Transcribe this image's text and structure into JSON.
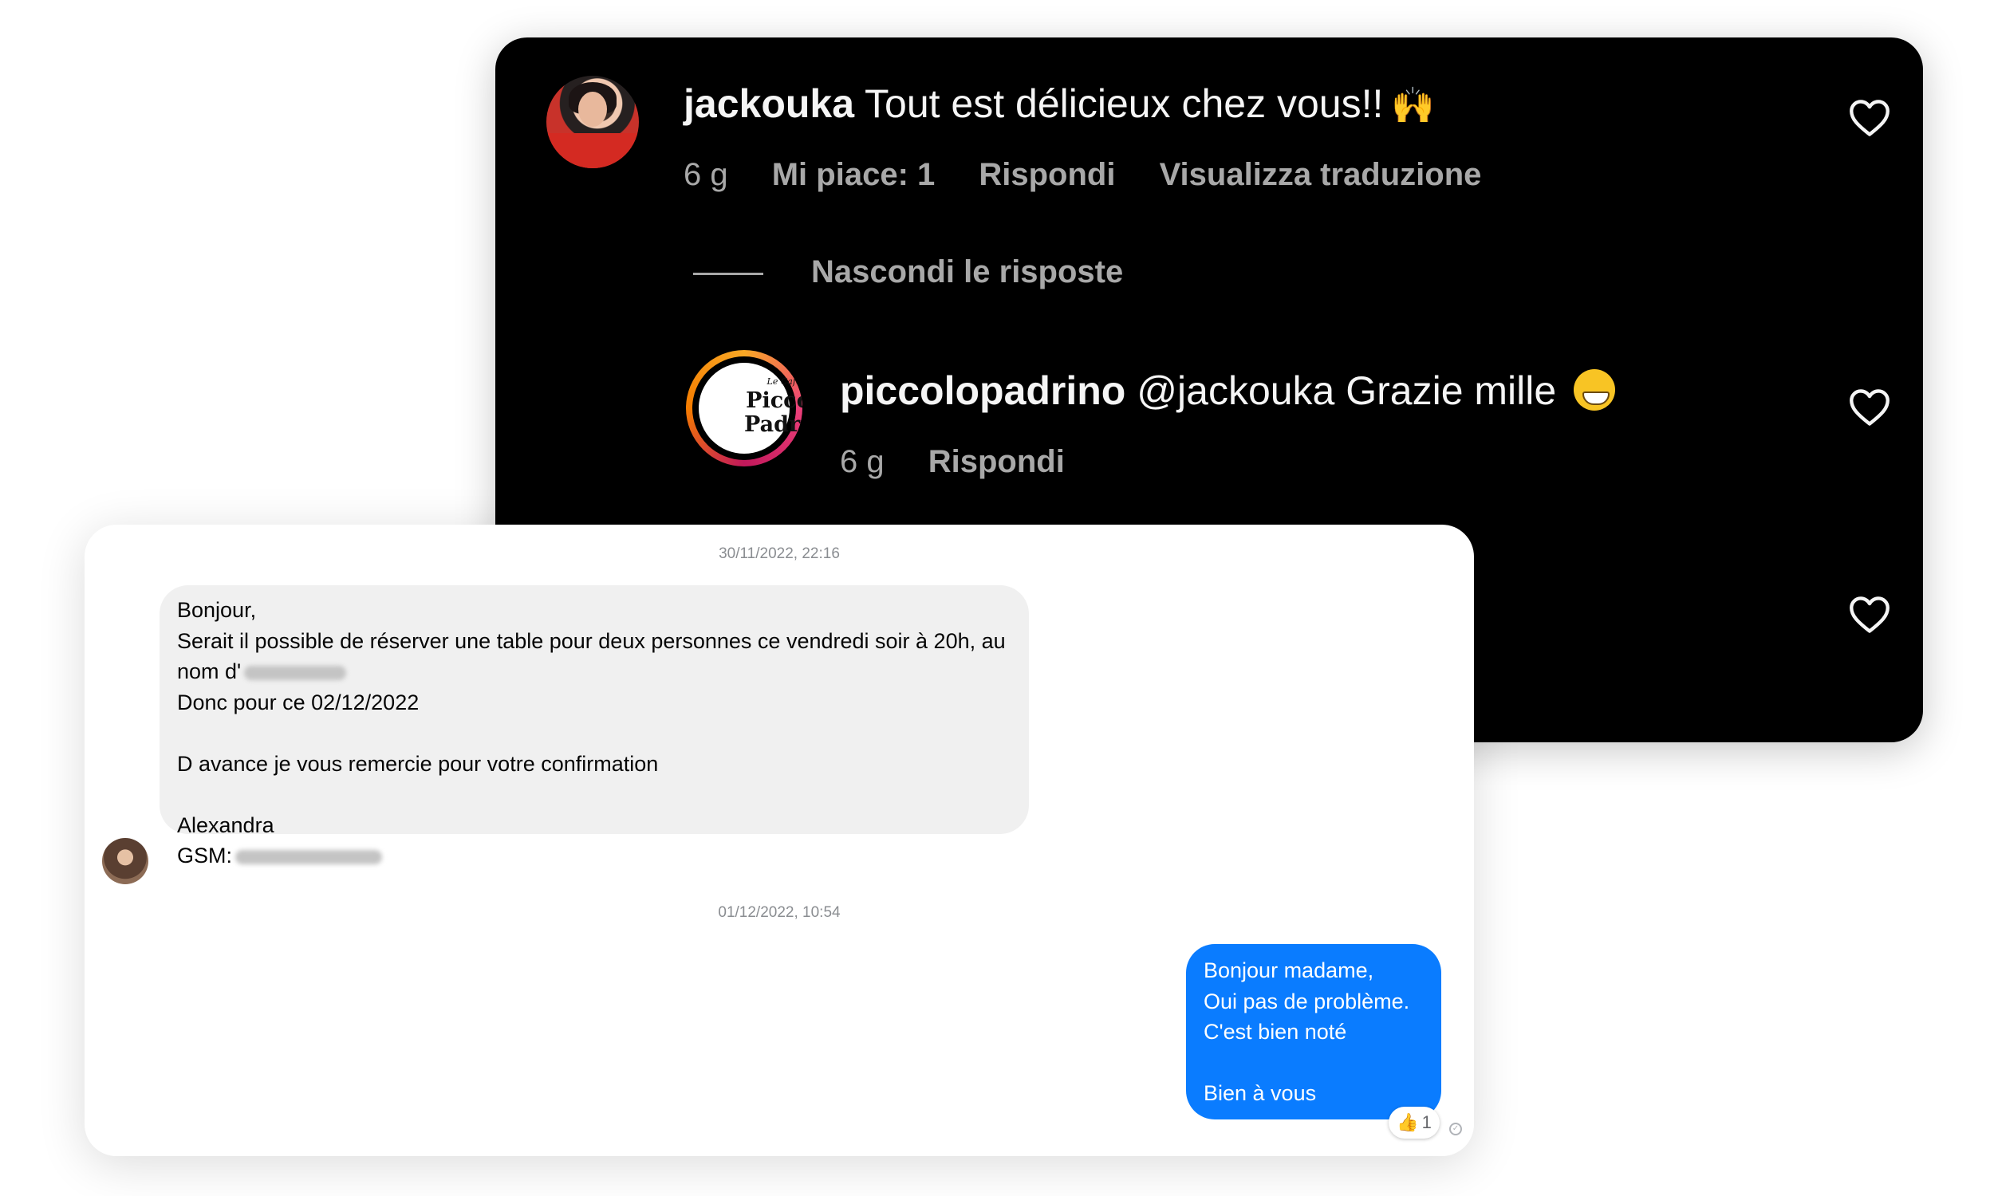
{
  "instagram": {
    "comment": {
      "username": "jackouka",
      "text": "Tout est délicieux chez vous!!",
      "emoji": "🙌",
      "age": "6 g",
      "likes": "Mi piace: 1",
      "reply": "Rispondi",
      "translate": "Visualizza traduzione"
    },
    "hide_replies": "Nascondi le risposte",
    "reply": {
      "username": "piccolopadrino",
      "text": "@jackouka Grazie mille",
      "age": "6 g",
      "reply": "Rispondi",
      "logo": {
        "top": "Le Café di",
        "main": "Piccolo",
        "sub": "Padrino"
      }
    }
  },
  "messenger": {
    "timestamp_1": "30/11/2022, 22:16",
    "incoming": {
      "line1": "Bonjour,",
      "line2": "Serait il possible de réserver une table pour deux personnes ce vendredi soir à 20h, au",
      "line3": "nom d'",
      "line4": "Donc pour ce 02/12/2022",
      "line5": "D avance je vous remercie pour votre confirmation",
      "line6": "Alexandra",
      "line7": "GSM:"
    },
    "timestamp_2": "01/12/2022, 10:54",
    "outgoing": {
      "line1": "Bonjour madame,",
      "line2": "Oui pas de problème.",
      "line3": "C'est bien noté",
      "line4": "Bien à vous"
    },
    "reaction": {
      "emoji": "👍",
      "count": "1"
    }
  }
}
